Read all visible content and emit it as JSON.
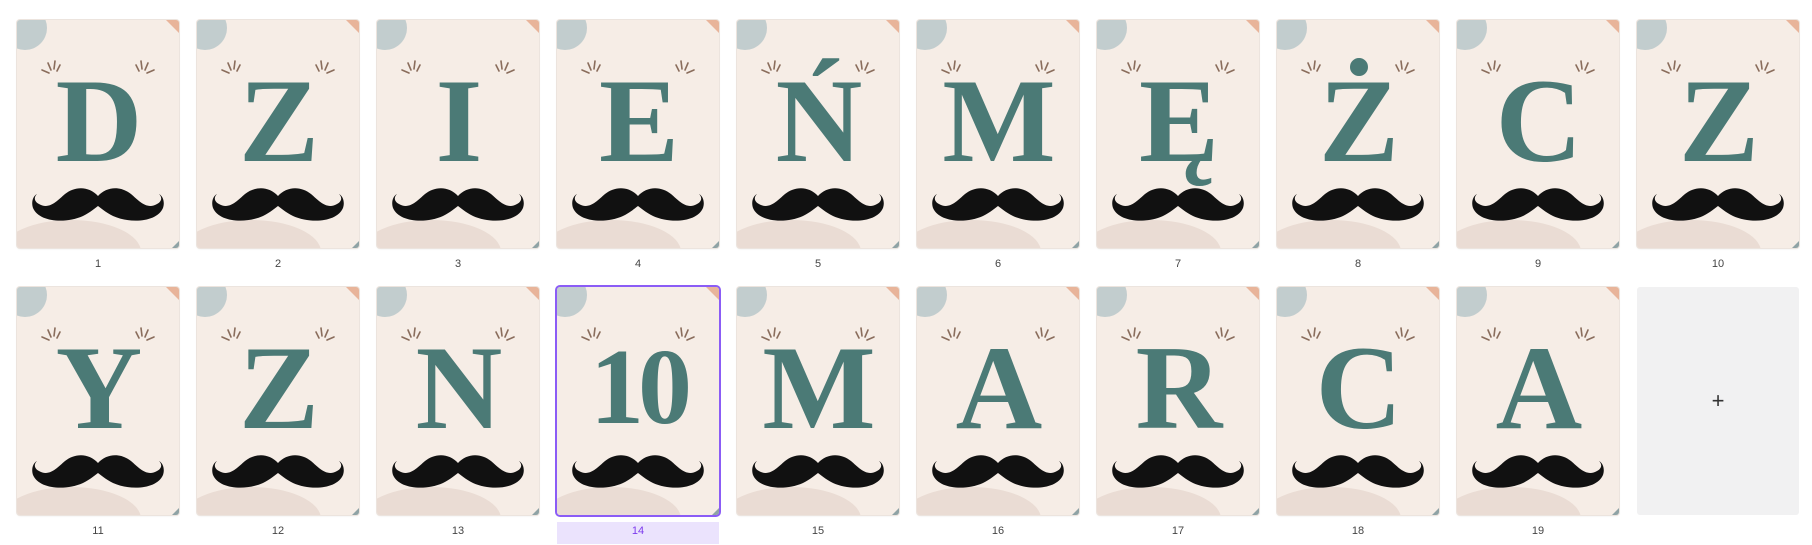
{
  "colors": {
    "card_background": "#f6ede6",
    "letter": "#4b7a76",
    "mustache": "#111111",
    "corner_circle": "#c2cdce",
    "corner_triangle": "#e8b49a",
    "sparkles": "#8a6d5c",
    "selection": "#8b5cf6"
  },
  "pages": [
    {
      "number": "1",
      "letter": "D"
    },
    {
      "number": "2",
      "letter": "Z"
    },
    {
      "number": "3",
      "letter": "I"
    },
    {
      "number": "4",
      "letter": "E"
    },
    {
      "number": "5",
      "letter": "Ń"
    },
    {
      "number": "6",
      "letter": "M"
    },
    {
      "number": "7",
      "letter": "Ę"
    },
    {
      "number": "8",
      "letter": "Ż"
    },
    {
      "number": "9",
      "letter": "C"
    },
    {
      "number": "10",
      "letter": "Z"
    },
    {
      "number": "11",
      "letter": "Y"
    },
    {
      "number": "12",
      "letter": "Z"
    },
    {
      "number": "13",
      "letter": "N"
    },
    {
      "number": "14",
      "letter": "10",
      "selected": true
    },
    {
      "number": "15",
      "letter": "M"
    },
    {
      "number": "16",
      "letter": "A"
    },
    {
      "number": "17",
      "letter": "R"
    },
    {
      "number": "18",
      "letter": "C"
    },
    {
      "number": "19",
      "letter": "A"
    }
  ],
  "add_page": {
    "label": "+"
  }
}
